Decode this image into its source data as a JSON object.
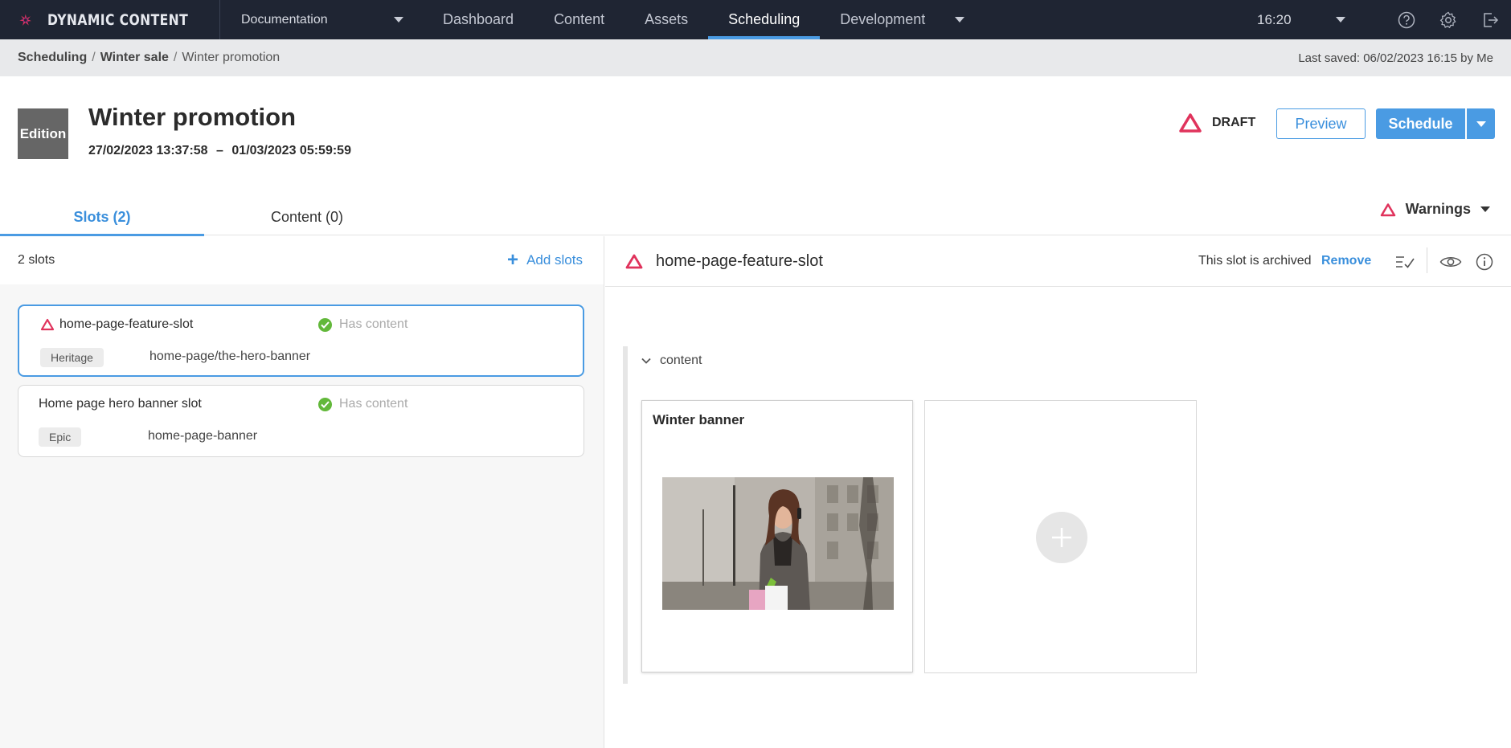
{
  "app": {
    "logo_text": "DYNAMIC CONTENT",
    "hub": "Documentation",
    "nav_tabs": [
      "Dashboard",
      "Content",
      "Assets",
      "Scheduling",
      "Development"
    ],
    "active_tab": "Scheduling",
    "clock": "16:20"
  },
  "breadcrumb": {
    "items": [
      "Scheduling",
      "Winter sale",
      "Winter promotion"
    ],
    "last_saved": "Last saved: 06/02/2023 16:15 by Me"
  },
  "header": {
    "type_label": "Edition",
    "title": "Winter promotion",
    "start": "27/02/2023 13:37:58",
    "separator": "–",
    "end": "01/03/2023 05:59:59",
    "status": "DRAFT",
    "preview_label": "Preview",
    "schedule_label": "Schedule"
  },
  "tabs": [
    {
      "label": "Slots (2)",
      "active": true
    },
    {
      "label": "Content (0)",
      "active": false
    }
  ],
  "warnings_label": "Warnings",
  "slots_panel": {
    "count_label": "2 slots",
    "add_label": "Add slots",
    "slots": [
      {
        "name": "home-page-feature-slot",
        "status": "Has content",
        "badge": "Heritage",
        "path": "home-page/the-hero-banner",
        "warning": true,
        "selected": true
      },
      {
        "name": "Home page hero banner slot",
        "status": "Has content",
        "badge": "Epic",
        "path": "home-page-banner",
        "warning": false,
        "selected": false
      }
    ]
  },
  "slot_detail": {
    "name": "home-page-feature-slot",
    "archived_text": "This slot is archived",
    "remove_label": "Remove",
    "content_section": "content",
    "item_title": "Winter banner"
  },
  "colors": {
    "topbar": "#1f2533",
    "accent": "#4a9be3",
    "warning": "#e0335c",
    "success": "#62b83a"
  },
  "icons": [
    "logo-icon",
    "help-icon",
    "settings-icon",
    "logout-icon",
    "warning-icon",
    "check-icon",
    "plus-icon",
    "checklist-icon",
    "eye-icon",
    "info-icon",
    "chevron-down-icon"
  ]
}
